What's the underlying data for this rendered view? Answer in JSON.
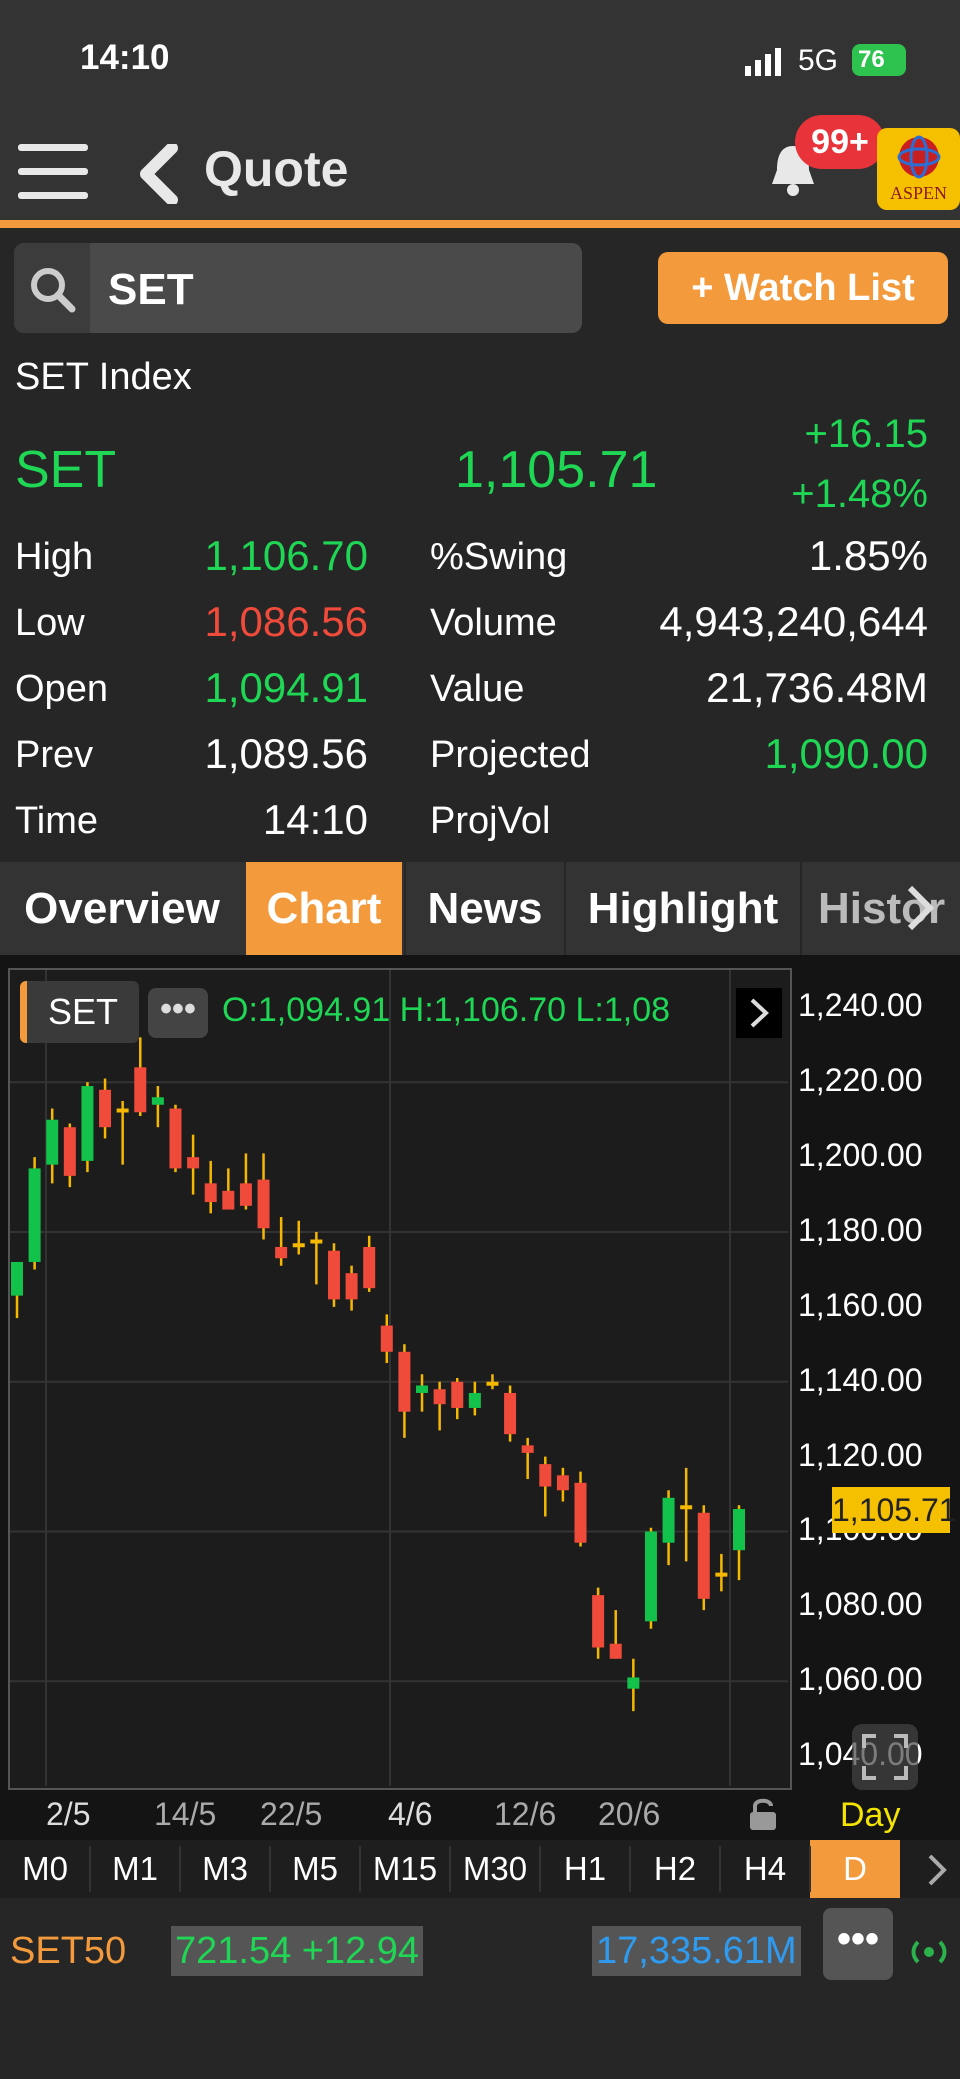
{
  "status_bar": {
    "time": "14:10",
    "network": "5G",
    "battery": "76"
  },
  "nav": {
    "title": "Quote",
    "badge": "99+",
    "logo_text": "ASPEN"
  },
  "search": {
    "value": "SET",
    "watch_button": "+ Watch List"
  },
  "quote": {
    "index_name": "SET Index",
    "symbol": "SET",
    "last": "1,105.71",
    "change": "+16.15",
    "pct_change": "+1.48%",
    "rows": [
      {
        "label": "High",
        "value": "1,106.70",
        "color": "#1fd655",
        "label2": "%Swing",
        "value2": "1.85%",
        "color2": "#ffffff"
      },
      {
        "label": "Low",
        "value": "1,086.56",
        "color": "#f04a3a",
        "label2": "Volume",
        "value2": "4,943,240,644",
        "color2": "#ffffff"
      },
      {
        "label": "Open",
        "value": "1,094.91",
        "color": "#1fd655",
        "label2": "Value",
        "value2": "21,736.48M",
        "color2": "#ffffff"
      },
      {
        "label": "Prev",
        "value": "1,089.56",
        "color": "#ffffff",
        "label2": "Projected",
        "value2": "1,090.00",
        "color2": "#1fd655"
      },
      {
        "label": "Time",
        "value": "14:10",
        "color": "#ffffff",
        "label2": "ProjVol",
        "value2": "",
        "color2": "#ffffff"
      }
    ]
  },
  "tabs": [
    "Overview",
    "Chart",
    "News",
    "Highlight",
    "Histor"
  ],
  "active_tab": "Chart",
  "chart_header": {
    "symbol": "SET",
    "ohl_text": "O:1,094.91  H:1,106.70  L:1,08"
  },
  "chart_data": {
    "type": "candlestick",
    "ylim": [
      1030,
      1250
    ],
    "y_ticks": [
      "1,240.00",
      "1,220.00",
      "1,200.00",
      "1,180.00",
      "1,160.00",
      "1,140.00",
      "1,120.00",
      "1,100.00",
      "1,080.00",
      "1,060.00",
      "1,040.00"
    ],
    "x_tick_labels": [
      "2/5",
      "14/5",
      "22/5",
      "4/6",
      "12/6",
      "20/6"
    ],
    "current_price_label": "1,105.71",
    "period_label": "Day",
    "candles": [
      {
        "o": 1163,
        "h": 1170,
        "l": 1157,
        "c": 1172
      },
      {
        "o": 1172,
        "h": 1200,
        "l": 1170,
        "c": 1197
      },
      {
        "o": 1198,
        "h": 1213,
        "l": 1193,
        "c": 1210
      },
      {
        "o": 1208,
        "h": 1209,
        "l": 1192,
        "c": 1195
      },
      {
        "o": 1199,
        "h": 1220,
        "l": 1196,
        "c": 1219
      },
      {
        "o": 1218,
        "h": 1221,
        "l": 1205,
        "c": 1208
      },
      {
        "o": 1212,
        "h": 1215,
        "l": 1198,
        "c": 1213
      },
      {
        "o": 1224,
        "h": 1232,
        "l": 1211,
        "c": 1212
      },
      {
        "o": 1214,
        "h": 1219,
        "l": 1208,
        "c": 1216
      },
      {
        "o": 1213,
        "h": 1214,
        "l": 1196,
        "c": 1197
      },
      {
        "o": 1200,
        "h": 1206,
        "l": 1190,
        "c": 1197
      },
      {
        "o": 1193,
        "h": 1199,
        "l": 1185,
        "c": 1188
      },
      {
        "o": 1191,
        "h": 1197,
        "l": 1187,
        "c": 1186
      },
      {
        "o": 1193,
        "h": 1201,
        "l": 1186,
        "c": 1187
      },
      {
        "o": 1194,
        "h": 1201,
        "l": 1178,
        "c": 1181
      },
      {
        "o": 1176,
        "h": 1184,
        "l": 1171,
        "c": 1173
      },
      {
        "o": 1177,
        "h": 1183,
        "l": 1174,
        "c": 1176
      },
      {
        "o": 1178,
        "h": 1180,
        "l": 1166,
        "c": 1177
      },
      {
        "o": 1175,
        "h": 1177,
        "l": 1160,
        "c": 1162
      },
      {
        "o": 1169,
        "h": 1171,
        "l": 1159,
        "c": 1162
      },
      {
        "o": 1176,
        "h": 1179,
        "l": 1164,
        "c": 1165
      },
      {
        "o": 1155,
        "h": 1158,
        "l": 1145,
        "c": 1148
      },
      {
        "o": 1148,
        "h": 1150,
        "l": 1125,
        "c": 1132
      },
      {
        "o": 1137,
        "h": 1142,
        "l": 1132,
        "c": 1139
      },
      {
        "o": 1138,
        "h": 1140,
        "l": 1127,
        "c": 1134
      },
      {
        "o": 1140,
        "h": 1141,
        "l": 1130,
        "c": 1133
      },
      {
        "o": 1133,
        "h": 1140,
        "l": 1131,
        "c": 1137
      },
      {
        "o": 1140,
        "h": 1142,
        "l": 1138,
        "c": 1139
      },
      {
        "o": 1137,
        "h": 1139,
        "l": 1124,
        "c": 1126
      },
      {
        "o": 1123,
        "h": 1125,
        "l": 1114,
        "c": 1121
      },
      {
        "o": 1118,
        "h": 1120,
        "l": 1104,
        "c": 1112
      },
      {
        "o": 1115,
        "h": 1117,
        "l": 1108,
        "c": 1111
      },
      {
        "o": 1113,
        "h": 1116,
        "l": 1096,
        "c": 1097
      },
      {
        "o": 1083,
        "h": 1085,
        "l": 1066,
        "c": 1069
      },
      {
        "o": 1070,
        "h": 1079,
        "l": 1066,
        "c": 1066
      },
      {
        "o": 1058,
        "h": 1066,
        "l": 1052,
        "c": 1061
      },
      {
        "o": 1076,
        "h": 1101,
        "l": 1074,
        "c": 1100
      },
      {
        "o": 1097,
        "h": 1111,
        "l": 1091,
        "c": 1109
      },
      {
        "o": 1107,
        "h": 1117,
        "l": 1092,
        "c": 1106
      },
      {
        "o": 1105,
        "h": 1107,
        "l": 1079,
        "c": 1082
      },
      {
        "o": 1089,
        "h": 1094,
        "l": 1084,
        "c": 1089
      },
      {
        "o": 1095,
        "h": 1107,
        "l": 1087,
        "c": 1106
      }
    ],
    "up_color": "#12c24a",
    "down_color": "#f04a3a",
    "flat_color": "#f5b800"
  },
  "intervals": [
    "M0",
    "M1",
    "M3",
    "M5",
    "M15",
    "M30",
    "H1",
    "H2",
    "H4",
    "D"
  ],
  "active_interval": "D",
  "ticker": {
    "symbol": "SET50",
    "value": "721.54 +12.94",
    "trade_value": "17,335.61M"
  }
}
